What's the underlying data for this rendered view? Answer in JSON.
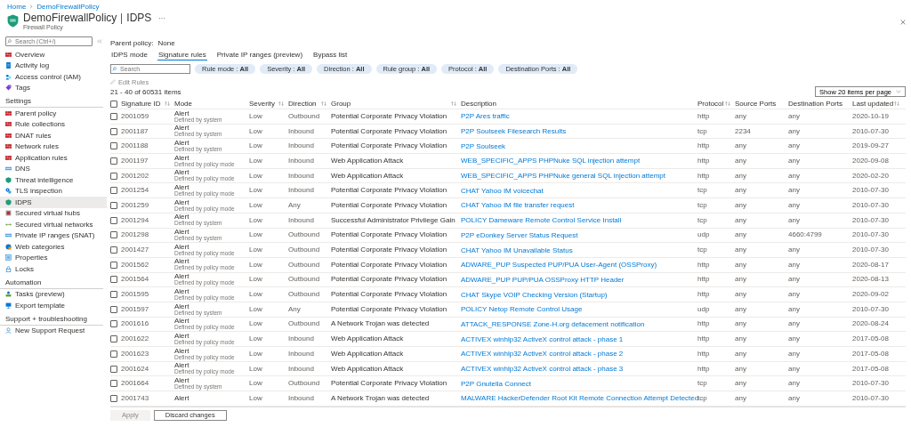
{
  "breadcrumb": [
    "Home",
    "DemoFirewallPolicy"
  ],
  "header": {
    "title": "DemoFirewallPolicy",
    "section": "IDPS",
    "subtitle": "Firewall Policy"
  },
  "sidebar": {
    "search_placeholder": "Search (Ctrl+/)",
    "groups": [
      {
        "items": [
          {
            "label": "Overview",
            "selected": false
          },
          {
            "label": "Activity log",
            "selected": false
          },
          {
            "label": "Access control (IAM)",
            "selected": false
          },
          {
            "label": "Tags",
            "selected": false
          }
        ]
      },
      {
        "heading": "Settings",
        "items": [
          {
            "label": "Parent policy",
            "selected": false
          },
          {
            "label": "Rule collections",
            "selected": false
          },
          {
            "label": "DNAT rules",
            "selected": false
          },
          {
            "label": "Network rules",
            "selected": false
          },
          {
            "label": "Application rules",
            "selected": false
          },
          {
            "label": "DNS",
            "selected": false
          },
          {
            "label": "Threat intelligence",
            "selected": false
          },
          {
            "label": "TLS inspection",
            "selected": false
          },
          {
            "label": "IDPS",
            "selected": true
          },
          {
            "label": "Secured virtual hubs",
            "selected": false
          },
          {
            "label": "Secured virtual networks",
            "selected": false
          },
          {
            "label": "Private IP ranges (SNAT)",
            "selected": false
          },
          {
            "label": "Web categories",
            "selected": false
          },
          {
            "label": "Properties",
            "selected": false
          },
          {
            "label": "Locks",
            "selected": false
          }
        ]
      },
      {
        "heading": "Automation",
        "items": [
          {
            "label": "Tasks (preview)",
            "selected": false
          },
          {
            "label": "Export template",
            "selected": false
          }
        ]
      },
      {
        "heading": "Support + troubleshooting",
        "items": [
          {
            "label": "New Support Request",
            "selected": false
          }
        ]
      }
    ]
  },
  "parent_policy": {
    "label": "Parent policy:",
    "value": "None"
  },
  "tabs": [
    {
      "label": "IDPS mode",
      "selected": false
    },
    {
      "label": "Signature rules",
      "selected": true
    },
    {
      "label": "Private IP ranges (preview)",
      "selected": false
    },
    {
      "label": "Bypass list",
      "selected": false
    }
  ],
  "filters": {
    "search_placeholder": "Search",
    "pills": [
      "Rule mode : **All**",
      "Severity : **All**",
      "Direction : **All**",
      "Rule group : **All**",
      "Protocol : **All**",
      "Destination Ports : **All**"
    ]
  },
  "edit_rules": {
    "label": "Edit Rules",
    "disabled": true
  },
  "item_count": "21 - 40 of 60531 items",
  "page_size": "Show 20 items per page",
  "table": {
    "select_all_checked": false,
    "columns": [
      {
        "label": "Signature ID",
        "sortable": true
      },
      {
        "label": "Mode",
        "sortable": false
      },
      {
        "label": "Severity",
        "sortable": true
      },
      {
        "label": "Direction",
        "sortable": true
      },
      {
        "label": "Group",
        "sortable": true
      },
      {
        "label": "Description",
        "sortable": false
      },
      {
        "label": "Protocol",
        "sortable": true
      },
      {
        "label": "Source Ports",
        "sortable": false
      },
      {
        "label": "Destination Ports",
        "sortable": false
      },
      {
        "label": "Last updated",
        "sortable": true
      }
    ],
    "rows": [
      {
        "checked": false,
        "id": "2001059",
        "mode": "Alert",
        "mode_detail": "Defined by system",
        "severity": "Low",
        "direction": "Outbound",
        "group": "Potential Corporate Privacy Violation",
        "description": "P2P Ares traffic",
        "protocol": "http",
        "source_ports": "any",
        "destination_ports": "any",
        "last_updated": "2020-10-19"
      },
      {
        "checked": false,
        "id": "2001187",
        "mode": "Alert",
        "mode_detail": "Defined by system",
        "severity": "Low",
        "direction": "Inbound",
        "group": "Potential Corporate Privacy Violation",
        "description": "P2P Soulseek Filesearch Results",
        "protocol": "tcp",
        "source_ports": "2234",
        "destination_ports": "any",
        "last_updated": "2010-07-30"
      },
      {
        "checked": false,
        "id": "2001188",
        "mode": "Alert",
        "mode_detail": "Defined by system",
        "severity": "Low",
        "direction": "Inbound",
        "group": "Potential Corporate Privacy Violation",
        "description": "P2P Soulseek",
        "protocol": "http",
        "source_ports": "any",
        "destination_ports": "any",
        "last_updated": "2019-09-27"
      },
      {
        "checked": false,
        "id": "2001197",
        "mode": "Alert",
        "mode_detail": "Defined by policy mode",
        "severity": "Low",
        "direction": "Inbound",
        "group": "Web Application Attack",
        "description": "WEB_SPECIFIC_APPS PHPNuke SQL injection attempt",
        "protocol": "http",
        "source_ports": "any",
        "destination_ports": "any",
        "last_updated": "2020-09-08"
      },
      {
        "checked": false,
        "id": "2001202",
        "mode": "Alert",
        "mode_detail": "Defined by policy mode",
        "severity": "Low",
        "direction": "Inbound",
        "group": "Web Application Attack",
        "description": "WEB_SPECIFIC_APPS PHPNuke general SQL injection attempt",
        "protocol": "http",
        "source_ports": "any",
        "destination_ports": "any",
        "last_updated": "2020-02-20"
      },
      {
        "checked": false,
        "id": "2001254",
        "mode": "Alert",
        "mode_detail": "Defined by policy mode",
        "severity": "Low",
        "direction": "Inbound",
        "group": "Potential Corporate Privacy Violation",
        "description": "CHAT Yahoo IM voicechat",
        "protocol": "tcp",
        "source_ports": "any",
        "destination_ports": "any",
        "last_updated": "2010-07-30"
      },
      {
        "checked": false,
        "id": "2001259",
        "mode": "Alert",
        "mode_detail": "Defined by policy mode",
        "severity": "Low",
        "direction": "Any",
        "group": "Potential Corporate Privacy Violation",
        "description": "CHAT Yahoo IM file transfer request",
        "protocol": "tcp",
        "source_ports": "any",
        "destination_ports": "any",
        "last_updated": "2010-07-30"
      },
      {
        "checked": false,
        "id": "2001294",
        "mode": "Alert",
        "mode_detail": "Defined by system",
        "severity": "Low",
        "direction": "Inbound",
        "group": "Successful Administrator Privilege Gain",
        "description": "POLICY Dameware Remote Control Service Install",
        "protocol": "tcp",
        "source_ports": "any",
        "destination_ports": "any",
        "last_updated": "2010-07-30"
      },
      {
        "checked": false,
        "id": "2001298",
        "mode": "Alert",
        "mode_detail": "Defined by system",
        "severity": "Low",
        "direction": "Outbound",
        "group": "Potential Corporate Privacy Violation",
        "description": "P2P eDonkey Server Status Request",
        "protocol": "udp",
        "source_ports": "any",
        "destination_ports": "4660:4799",
        "last_updated": "2010-07-30"
      },
      {
        "checked": false,
        "id": "2001427",
        "mode": "Alert",
        "mode_detail": "Defined by policy mode",
        "severity": "Low",
        "direction": "Outbound",
        "group": "Potential Corporate Privacy Violation",
        "description": "CHAT Yahoo IM Unavailable Status",
        "protocol": "tcp",
        "source_ports": "any",
        "destination_ports": "any",
        "last_updated": "2010-07-30"
      },
      {
        "checked": false,
        "id": "2001562",
        "mode": "Alert",
        "mode_detail": "Defined by policy mode",
        "severity": "Low",
        "direction": "Outbound",
        "group": "Potential Corporate Privacy Violation",
        "description": "ADWARE_PUP Suspected PUP/PUA User-Agent (OSSProxy)",
        "protocol": "http",
        "source_ports": "any",
        "destination_ports": "any",
        "last_updated": "2020-08-17"
      },
      {
        "checked": false,
        "id": "2001564",
        "mode": "Alert",
        "mode_detail": "Defined by policy mode",
        "severity": "Low",
        "direction": "Outbound",
        "group": "Potential Corporate Privacy Violation",
        "description": "ADWARE_PUP PUP/PUA OSSProxy HTTP Header",
        "protocol": "http",
        "source_ports": "any",
        "destination_ports": "any",
        "last_updated": "2020-08-13"
      },
      {
        "checked": false,
        "id": "2001595",
        "mode": "Alert",
        "mode_detail": "Defined by policy mode",
        "severity": "Low",
        "direction": "Outbound",
        "group": "Potential Corporate Privacy Violation",
        "description": "CHAT Skype VOIP Checking Version (Startup)",
        "protocol": "http",
        "source_ports": "any",
        "destination_ports": "any",
        "last_updated": "2020-09-02"
      },
      {
        "checked": false,
        "id": "2001597",
        "mode": "Alert",
        "mode_detail": "Defined by system",
        "severity": "Low",
        "direction": "Any",
        "group": "Potential Corporate Privacy Violation",
        "description": "POLICY Netop Remote Control Usage",
        "protocol": "udp",
        "source_ports": "any",
        "destination_ports": "any",
        "last_updated": "2010-07-30"
      },
      {
        "checked": false,
        "id": "2001616",
        "mode": "Alert",
        "mode_detail": "Defined by policy mode",
        "severity": "Low",
        "direction": "Outbound",
        "group": "A Network Trojan was detected",
        "description": "ATTACK_RESPONSE Zone-H.org defacement notification",
        "protocol": "http",
        "source_ports": "any",
        "destination_ports": "any",
        "last_updated": "2020-08-24"
      },
      {
        "checked": false,
        "id": "2001622",
        "mode": "Alert",
        "mode_detail": "Defined by policy mode",
        "severity": "Low",
        "direction": "Inbound",
        "group": "Web Application Attack",
        "description": "ACTIVEX winhlp32 ActiveX control attack - phase 1",
        "protocol": "http",
        "source_ports": "any",
        "destination_ports": "any",
        "last_updated": "2017-05-08"
      },
      {
        "checked": false,
        "id": "2001623",
        "mode": "Alert",
        "mode_detail": "Defined by policy mode",
        "severity": "Low",
        "direction": "Inbound",
        "group": "Web Application Attack",
        "description": "ACTIVEX winhlp32 ActiveX control attack - phase 2",
        "protocol": "http",
        "source_ports": "any",
        "destination_ports": "any",
        "last_updated": "2017-05-08"
      },
      {
        "checked": false,
        "id": "2001624",
        "mode": "Alert",
        "mode_detail": "Defined by policy mode",
        "severity": "Low",
        "direction": "Inbound",
        "group": "Web Application Attack",
        "description": "ACTIVEX winhlp32 ActiveX control attack - phase 3",
        "protocol": "http",
        "source_ports": "any",
        "destination_ports": "any",
        "last_updated": "2017-05-08"
      },
      {
        "checked": false,
        "id": "2001664",
        "mode": "Alert",
        "mode_detail": "Defined by system",
        "severity": "Low",
        "direction": "Outbound",
        "group": "Potential Corporate Privacy Violation",
        "description": "P2P Gnutella Connect",
        "protocol": "tcp",
        "source_ports": "any",
        "destination_ports": "any",
        "last_updated": "2010-07-30"
      },
      {
        "checked": false,
        "id": "2001743",
        "mode": "Alert",
        "severity": "Low",
        "direction": "Inbound",
        "group": "A Network Trojan was detected",
        "description": "MALWARE HackerDefender Root Kit Remote Connection Attempt Detected",
        "protocol": "tcp",
        "source_ports": "any",
        "destination_ports": "any",
        "last_updated": "2010-07-30"
      }
    ]
  },
  "buttons": [
    {
      "label": "Apply",
      "disabled": true
    },
    {
      "label": "Discard changes",
      "disabled": false
    }
  ]
}
